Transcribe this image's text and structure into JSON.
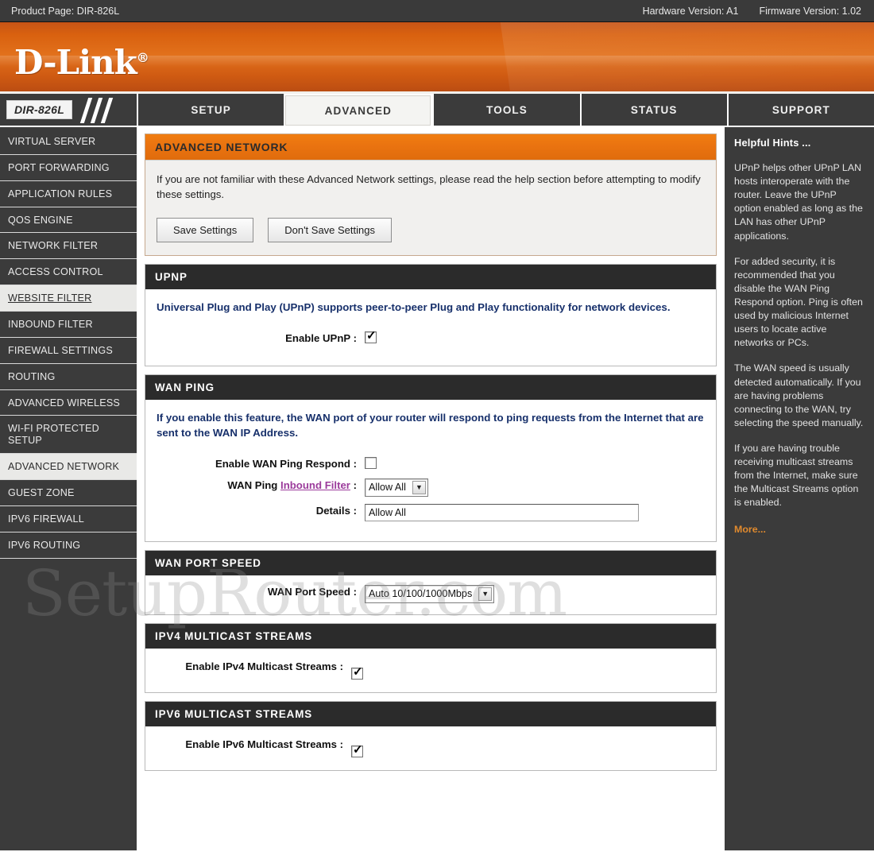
{
  "topbar": {
    "product_page": "Product Page: DIR-826L",
    "hardware_version": "Hardware Version: A1",
    "firmware_version": "Firmware Version: 1.02"
  },
  "brand": {
    "logo_text": "D-Link",
    "logo_mark": "®"
  },
  "nav": {
    "model_badge": "DIR-826L",
    "tabs": [
      {
        "label": "SETUP",
        "active": false
      },
      {
        "label": "ADVANCED",
        "active": true
      },
      {
        "label": "TOOLS",
        "active": false
      },
      {
        "label": "STATUS",
        "active": false
      },
      {
        "label": "SUPPORT",
        "active": false
      }
    ]
  },
  "sidebar": {
    "items": [
      {
        "label": "VIRTUAL SERVER",
        "state": "normal"
      },
      {
        "label": "PORT FORWARDING",
        "state": "normal"
      },
      {
        "label": "APPLICATION RULES",
        "state": "normal"
      },
      {
        "label": "QOS ENGINE",
        "state": "normal"
      },
      {
        "label": "NETWORK FILTER",
        "state": "normal"
      },
      {
        "label": "ACCESS CONTROL",
        "state": "normal"
      },
      {
        "label": "WEBSITE FILTER",
        "state": "hover"
      },
      {
        "label": "INBOUND FILTER",
        "state": "normal"
      },
      {
        "label": "FIREWALL SETTINGS",
        "state": "normal"
      },
      {
        "label": "ROUTING",
        "state": "normal"
      },
      {
        "label": "ADVANCED WIRELESS",
        "state": "normal"
      },
      {
        "label": "WI-FI PROTECTED SETUP",
        "state": "normal"
      },
      {
        "label": "ADVANCED NETWORK",
        "state": "active"
      },
      {
        "label": "GUEST ZONE",
        "state": "normal"
      },
      {
        "label": "IPV6 FIREWALL",
        "state": "normal"
      },
      {
        "label": "IPV6 ROUTING",
        "state": "normal"
      }
    ]
  },
  "page": {
    "title": "ADVANCED NETWORK",
    "intro": "If you are not familiar with these Advanced Network settings, please read the help section before attempting to modify these settings.",
    "save_label": "Save Settings",
    "dont_save_label": "Don't Save Settings"
  },
  "upnp": {
    "heading": "UPNP",
    "description": "Universal Plug and Play (UPnP) supports peer-to-peer Plug and Play functionality for network devices.",
    "enable_label": "Enable UPnP :",
    "enable_checked": true
  },
  "wan_ping": {
    "heading": "WAN PING",
    "description": "If you enable this feature, the WAN port of your router will respond to ping requests from the Internet that are sent to the WAN IP Address.",
    "enable_label": "Enable WAN Ping Respond :",
    "enable_checked": false,
    "filter_label_prefix": "WAN Ping ",
    "filter_link_text": "Inbound Filter",
    "filter_label_suffix": " :",
    "filter_value": "Allow All",
    "details_label": "Details :",
    "details_value": "Allow All"
  },
  "wan_port_speed": {
    "heading": "WAN PORT SPEED",
    "label": "WAN Port Speed :",
    "value": "Auto 10/100/1000Mbps"
  },
  "ipv4_multicast": {
    "heading": "IPV4 MULTICAST STREAMS",
    "label": "Enable IPv4 Multicast Streams :",
    "checked": true
  },
  "ipv6_multicast": {
    "heading": "IPV6 MULTICAST STREAMS",
    "label": "Enable IPv6 Multicast Streams :",
    "checked": true
  },
  "hints": {
    "title": "Helpful Hints ...",
    "p1": "UPnP helps other UPnP LAN hosts interoperate with the router. Leave the UPnP option enabled as long as the LAN has other UPnP applications.",
    "p2": "For added security, it is recommended that you disable the WAN Ping Respond option. Ping is often used by malicious Internet users to locate active networks or PCs.",
    "p3": "The WAN speed is usually detected automatically. If you are having problems connecting to the WAN, try selecting the speed manually.",
    "p4": "If you are having trouble receiving multicast streams from the Internet, make sure the Multicast Streams option is enabled.",
    "more": "More..."
  },
  "watermark": {
    "text": "SetupRouter.com"
  },
  "colors": {
    "accent_orange": "#ea7310",
    "header_dark": "#2b2b2b",
    "chrome_dark": "#3b3b3b",
    "desc_blue": "#17306b",
    "link_purple": "#9b3b9b",
    "more_orange": "#e08a2e"
  }
}
